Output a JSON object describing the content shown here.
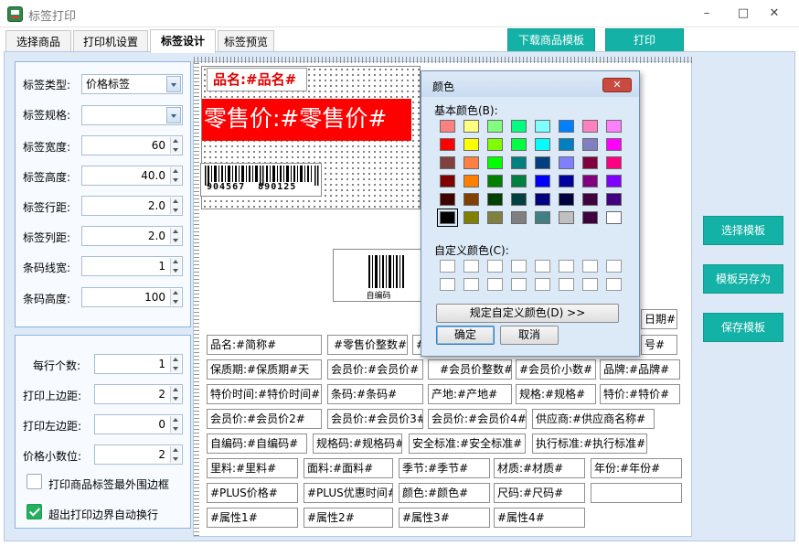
{
  "window": {
    "title": "标签打印",
    "min": "–",
    "max": "□",
    "close": "✕"
  },
  "tabs": [
    {
      "label": "选择商品"
    },
    {
      "label": "打印机设置"
    },
    {
      "label": "标签设计"
    },
    {
      "label": "标签预览"
    }
  ],
  "toolbar": {
    "download": "下载商品模板",
    "print": "打印"
  },
  "settings": {
    "label_type": {
      "label": "标签类型:",
      "value": "价格标签"
    },
    "label_spec": {
      "label": "标签规格:",
      "value": ""
    },
    "label_width": {
      "label": "标签宽度:",
      "value": "60"
    },
    "label_height": {
      "label": "标签高度:",
      "value": "40.0"
    },
    "row_gap": {
      "label": "标签行距:",
      "value": "2.0"
    },
    "col_gap": {
      "label": "标签列距:",
      "value": "2.0"
    },
    "barcode_line": {
      "label": "条码线宽:",
      "value": "1"
    },
    "barcode_height": {
      "label": "条码高度:",
      "value": "100"
    }
  },
  "print": {
    "per_row": {
      "label": "每行个数:",
      "value": "1"
    },
    "top_margin": {
      "label": "打印上边距:",
      "value": "2"
    },
    "left_margin": {
      "label": "打印左边距:",
      "value": "0"
    },
    "decimals": {
      "label": "价格小数位:",
      "value": "2"
    },
    "outer_border": {
      "label": "打印商品标签最外围边框",
      "checked": false
    },
    "auto_wrap": {
      "label": "超出打印边界自动换行",
      "checked": true
    }
  },
  "label": {
    "name": "品名:#品名#",
    "price": "零售价:#零售价#",
    "barcode_digits": "904567  890125"
  },
  "barcode2_caption": "自编码",
  "fields": [
    "日期#",
    "品名:#简称#",
    "#零售价整数#",
    "#",
    "号#",
    "保质期:#保质期#天",
    "会员价:#会员价#",
    "#会员价整数#",
    "#会员价小数#",
    "品牌:#品牌#",
    "特价时间:#特价时间#",
    "条码:#条码#",
    "产地:#产地#",
    "规格:#规格#",
    "特价:#特价#",
    "会员价:#会员价2#",
    "会员价:#会员价3#",
    "会员价:#会员价4#",
    "供应商:#供应商名称#",
    "自编码:#自编码#",
    "规格码:#规格码#",
    "安全标准:#安全标准#",
    "执行标准:#执行标准#",
    "里料:#里料#",
    "面料:#面料#",
    "季节:#季节#",
    "材质:#材质#",
    "年份:#年份#",
    "#PLUS价格#",
    "#PLUS优惠时间#",
    "颜色:#颜色#",
    "尺码:#尺码#",
    "",
    "#属性1#",
    "#属性2#",
    "#属性3#",
    "#属性4#"
  ],
  "sidebar": {
    "choose": "选择模板",
    "save_as": "模板另存为",
    "save": "保存模板"
  },
  "dialog": {
    "title": "颜色",
    "close": "✕",
    "basic": "基本颜色(B):",
    "custom": "自定义颜色(C):",
    "define": "规定自定义颜色(D) >>",
    "ok": "确定",
    "cancel": "取消",
    "basic_colors": [
      "#ff8080",
      "#ffff80",
      "#80ff80",
      "#00ff80",
      "#80ffff",
      "#0080ff",
      "#ff80c0",
      "#ff80ff",
      "#ff0000",
      "#ffff00",
      "#80ff00",
      "#00ff40",
      "#00ffff",
      "#0080c0",
      "#8080c0",
      "#ff00ff",
      "#804040",
      "#ff8040",
      "#00ff00",
      "#008080",
      "#004080",
      "#8080ff",
      "#800040",
      "#ff0080",
      "#800000",
      "#ff8000",
      "#008000",
      "#008040",
      "#0000ff",
      "#0000a0",
      "#800080",
      "#8000ff",
      "#400000",
      "#804000",
      "#004000",
      "#004040",
      "#000080",
      "#000040",
      "#400040",
      "#400080",
      "#000000",
      "#808000",
      "#808040",
      "#808080",
      "#408080",
      "#c0c0c0",
      "#400040",
      "#ffffff"
    ]
  }
}
